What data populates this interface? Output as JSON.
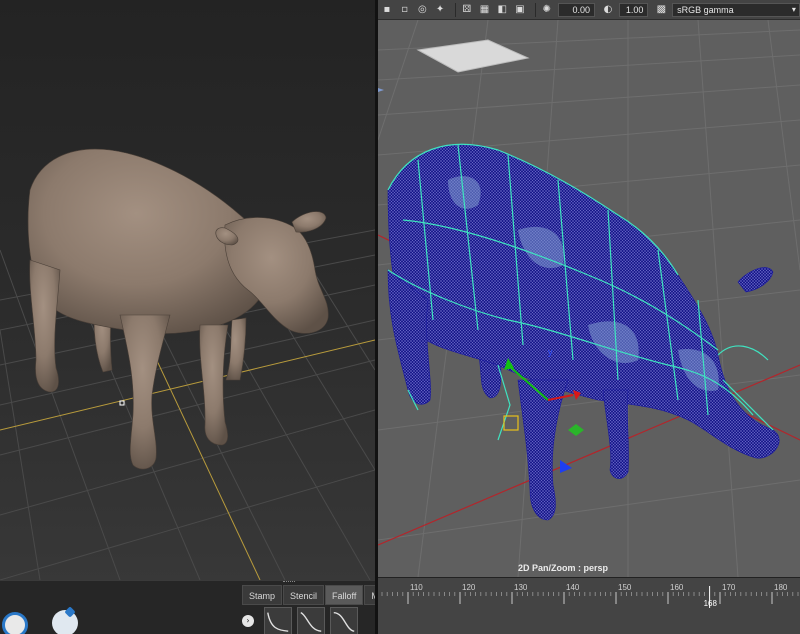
{
  "left_panel": {
    "tabs": [
      {
        "label": "Stamp",
        "active": false
      },
      {
        "label": "Stencil",
        "active": false
      },
      {
        "label": "Falloff",
        "active": true
      }
    ],
    "tab_overflow_label": "M",
    "falloff_button_label": "›",
    "model_color": "#8c7a6c",
    "grid_highlight_color": "#b89b3c"
  },
  "right_panel": {
    "toolbar": {
      "field_1": "0.00",
      "field_2": "1.00",
      "color_space": "sRGB gamma",
      "dropdown_arrow": "▾"
    },
    "camera_label": "2D Pan/Zoom : persp",
    "timeline": {
      "tick_labels": [
        "110",
        "120",
        "130",
        "140",
        "150",
        "160",
        "170",
        "180"
      ],
      "current_frame": "168"
    },
    "mesh_color": "#1a1a8c",
    "cage_color": "#3fe3c0",
    "grid_axis_color": "#b3252b"
  }
}
